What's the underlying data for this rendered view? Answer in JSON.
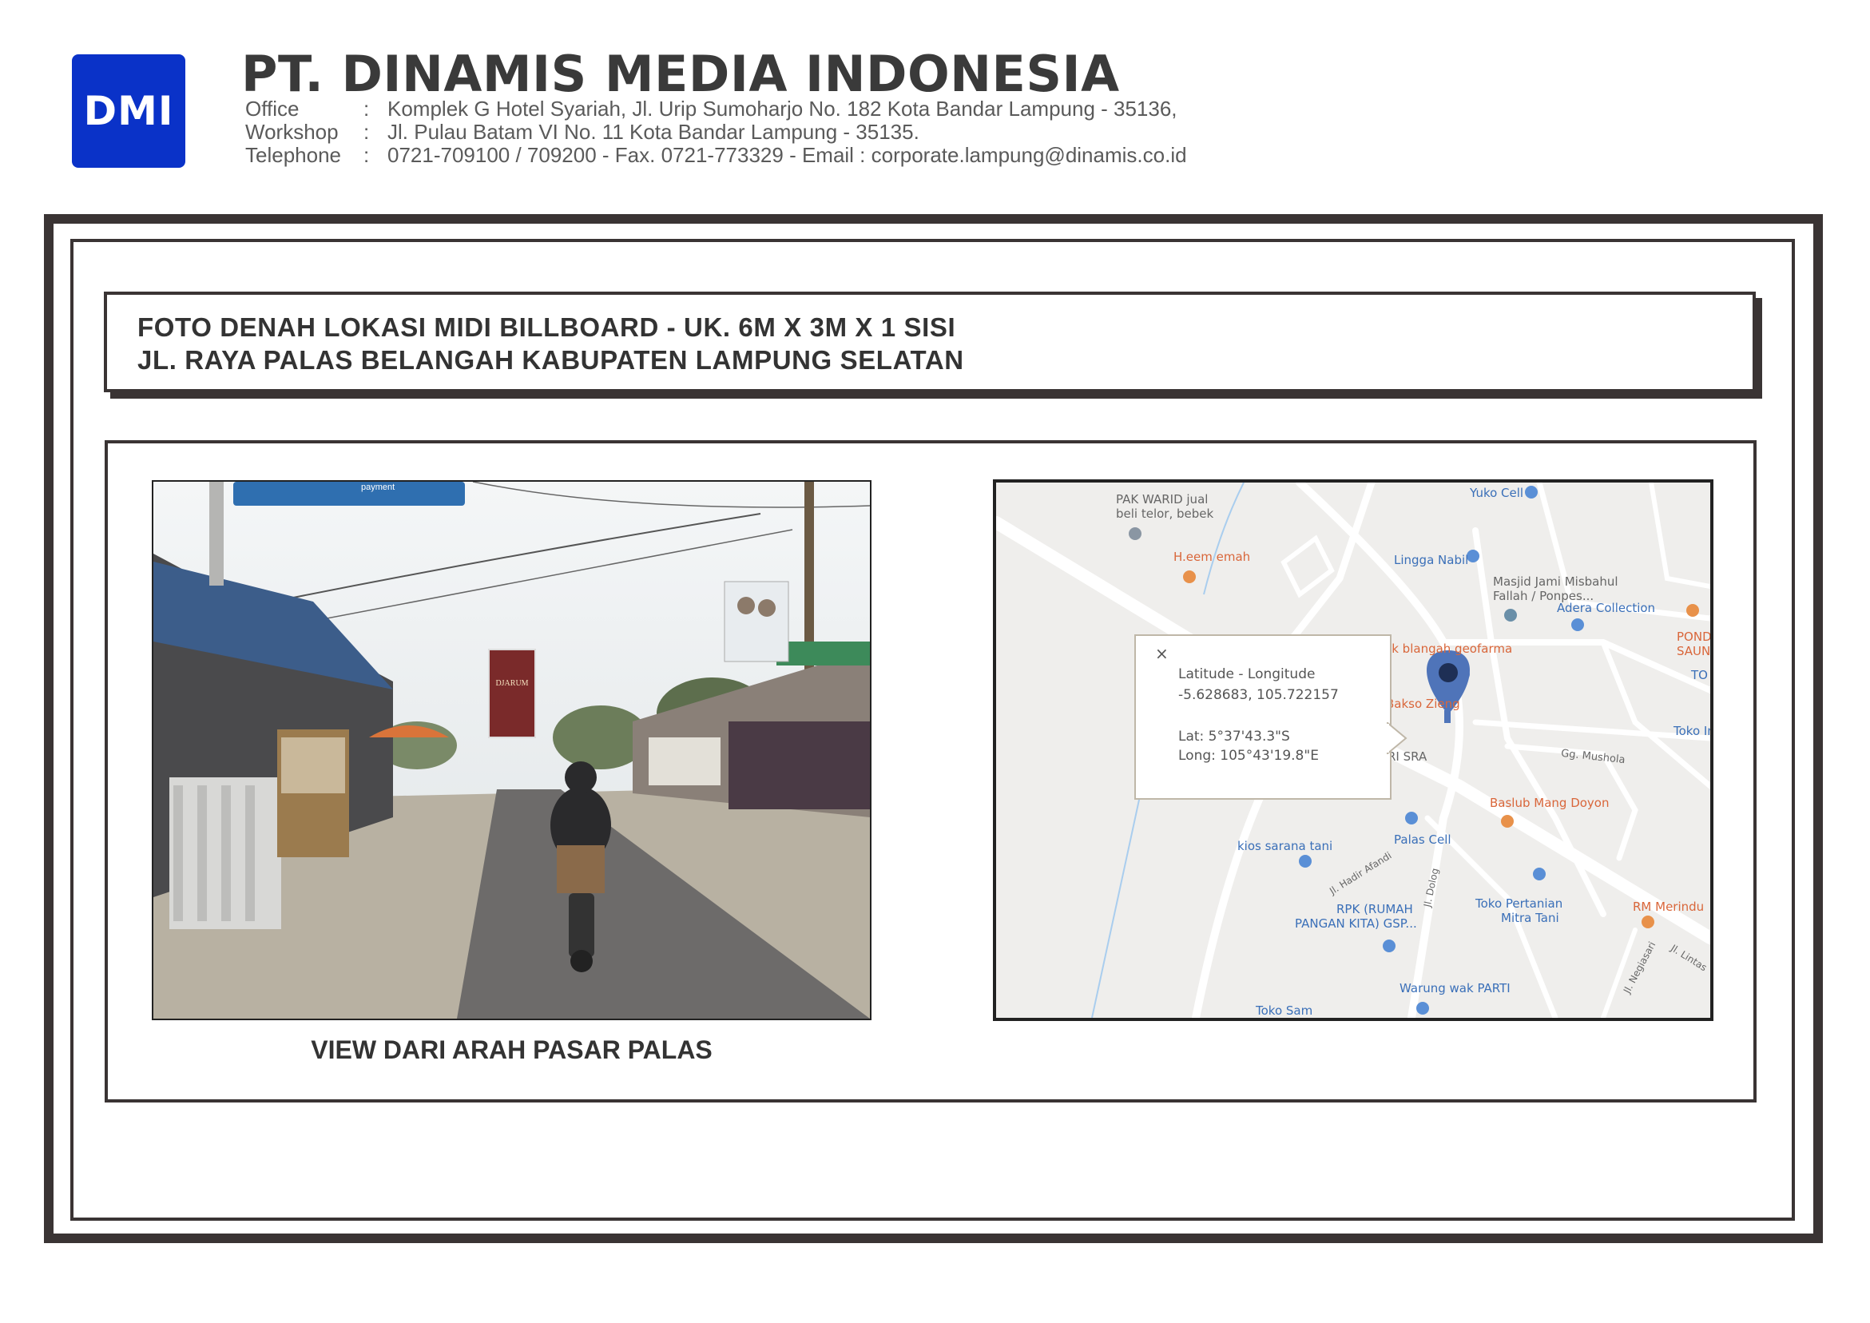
{
  "header": {
    "logo_text": "DMI",
    "company_name": "PT. DINAMIS MEDIA INDONESIA",
    "contacts": [
      {
        "label": "Office",
        "sep": ":",
        "value": "Komplek G Hotel Syariah, Jl. Urip  Sumoharjo No. 182 Kota Bandar Lampung - 35136,"
      },
      {
        "label": "Workshop",
        "sep": ":",
        "value": "Jl. Pulau Batam  VI  No. 11 Kota Bandar Lampung - 35135."
      },
      {
        "label": "Telephone",
        "sep": ":",
        "value": "0721-709100 / 709200 - Fax. 0721-773329 - Email : corporate.lampung@dinamis.co.id"
      }
    ],
    "colors": {
      "logo_bg": "#0a32c8",
      "frame": "#3a3434"
    }
  },
  "title": {
    "line1": "FOTO DENAH LOKASI MIDI BILLBOARD - UK. 6M X 3M X 1 SISI",
    "line2": "JL. RAYA PALAS BELANGAH KABUPATEN LAMPUNG SELATAN"
  },
  "photo": {
    "caption": "VIEW DARI ARAH PASAR PALAS",
    "sign_text": "payment",
    "billboard_text": "DJARUM"
  },
  "map": {
    "popup": {
      "close": "×",
      "heading": "Latitude - Longitude",
      "decimal": "-5.628683, 105.722157",
      "lat": "Lat: 5°37'43.3\"S",
      "long": "Long: 105°43'19.8\"E"
    },
    "places": [
      {
        "name": "PAK WARID jual",
        "color": "gray"
      },
      {
        "name": "beli telor, bebek",
        "color": "gray"
      },
      {
        "name": "Yuko Cell",
        "color": "blue"
      },
      {
        "name": "H.eem emah",
        "color": "orange"
      },
      {
        "name": "Lingga Nabil",
        "color": "blue"
      },
      {
        "name": "Masjid Jami Misbahul",
        "color": "gray"
      },
      {
        "name": "Fallah / Ponpes...",
        "color": "gray"
      },
      {
        "name": "Adera Collection",
        "color": "blue"
      },
      {
        "name": "PONDO",
        "color": "orange"
      },
      {
        "name": "SAUNG",
        "color": "orange"
      },
      {
        "name": "TO",
        "color": "blue"
      },
      {
        "name": "ek blangah geofarma",
        "color": "orange"
      },
      {
        "name": "Bakso Zieng",
        "color": "orange"
      },
      {
        "name": "Toko In",
        "color": "blue"
      },
      {
        "name": "RI SRA",
        "color": "gray"
      },
      {
        "name": "Gg. Mushola",
        "color": "gray"
      },
      {
        "name": "Baslub Mang Doyon",
        "color": "orange"
      },
      {
        "name": "kios sarana tani",
        "color": "blue"
      },
      {
        "name": "Palas Cell",
        "color": "blue"
      },
      {
        "name": "Jl. Hadir Afandi",
        "color": "gray"
      },
      {
        "name": "Jl. Dolog",
        "color": "gray"
      },
      {
        "name": "RPK (RUMAH",
        "color": "blue"
      },
      {
        "name": "PANGAN KITA) GSP...",
        "color": "blue"
      },
      {
        "name": "Toko Pertanian",
        "color": "blue"
      },
      {
        "name": "Mitra Tani",
        "color": "blue"
      },
      {
        "name": "RM Merindu",
        "color": "orange"
      },
      {
        "name": "Jl. Negiasari",
        "color": "gray"
      },
      {
        "name": "Jl. Lintas",
        "color": "gray"
      },
      {
        "name": "Warung wak PARTI",
        "color": "blue"
      },
      {
        "name": "Toko Sam",
        "color": "blue"
      }
    ]
  }
}
